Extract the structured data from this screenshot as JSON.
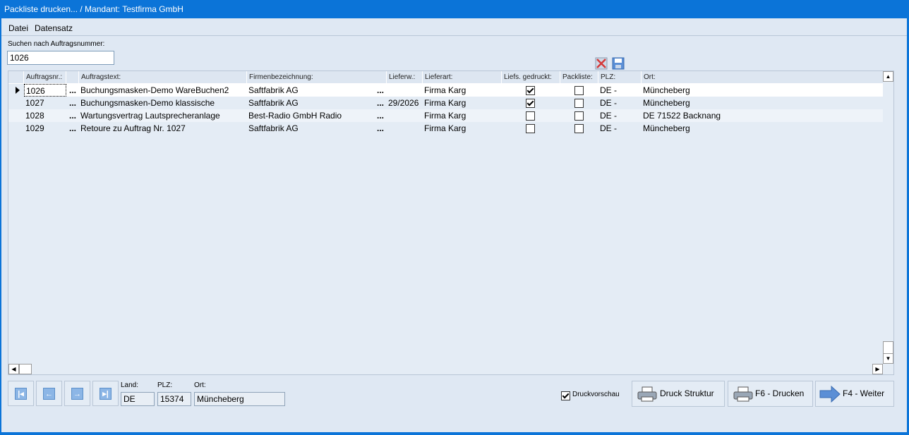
{
  "window": {
    "title": "Packliste drucken... / Mandant: Testfirma GmbH"
  },
  "menu": {
    "datei": "Datei",
    "datensatz": "Datensatz"
  },
  "search": {
    "label": "Suchen nach Auftragsnummer:",
    "value": "1026"
  },
  "grid": {
    "headers": {
      "auftragsnr": "Auftragsnr.:",
      "auftragstext": "Auftragstext:",
      "firmenbezeichnung": "Firmenbezeichnung:",
      "lieferw": "Lieferw.:",
      "lieferart": "Lieferart:",
      "liefs_gedruckt": "Liefs. gedruckt:",
      "packliste": "Packliste:",
      "plz": "PLZ:",
      "ort": "Ort:"
    },
    "rows": [
      {
        "nr": "1026",
        "text": "Buchungsmasken-Demo WareBuchen2",
        "firma": "Saftfabrik AG",
        "lieferw": "",
        "lieferart": "Firma Karg",
        "gedruckt": true,
        "packliste": false,
        "plz": "DE -",
        "ort": "Müncheberg"
      },
      {
        "nr": "1027",
        "text": "Buchungsmasken-Demo klassische",
        "firma": "Saftfabrik AG",
        "lieferw": "29/2026",
        "lieferart": "Firma Karg",
        "gedruckt": true,
        "packliste": false,
        "plz": "DE -",
        "ort": "Müncheberg"
      },
      {
        "nr": "1028",
        "text": "Wartungsvertrag Lautsprecheranlage",
        "firma": "Best-Radio GmbH Radio",
        "lieferw": "",
        "lieferart": "Firma Karg",
        "gedruckt": false,
        "packliste": false,
        "plz": "DE -",
        "ort": "DE 71522 Backnang"
      },
      {
        "nr": "1029",
        "text": "Retoure zu Auftrag Nr. 1027",
        "firma": "Saftfabrik AG",
        "lieferw": "",
        "lieferart": "Firma Karg",
        "gedruckt": false,
        "packliste": false,
        "plz": "DE -",
        "ort": "Müncheberg"
      }
    ],
    "ellipsis": "..."
  },
  "footer": {
    "land_label": "Land:",
    "land": "DE",
    "plz_label": "PLZ:",
    "plz": "15374",
    "ort_label": "Ort:",
    "ort": "Müncheberg",
    "druckvorschau_label": "Druckvorschau",
    "druckvorschau_checked": true,
    "btn_struktur": "Druck Struktur",
    "btn_drucken": "F6 - Drucken",
    "btn_weiter": "F4 - Weiter"
  },
  "colors": {
    "titlebar": "#0b74d8",
    "background": "#dfe8f3",
    "accent_icon": "#8cb6e6"
  },
  "icons": {
    "delete": "delete-x-icon",
    "save": "save-disk-icon",
    "first": "first-record-icon",
    "prev": "prev-record-icon",
    "next": "next-record-icon",
    "last": "last-record-icon",
    "printer": "printer-icon",
    "arrow": "arrow-right-icon"
  }
}
